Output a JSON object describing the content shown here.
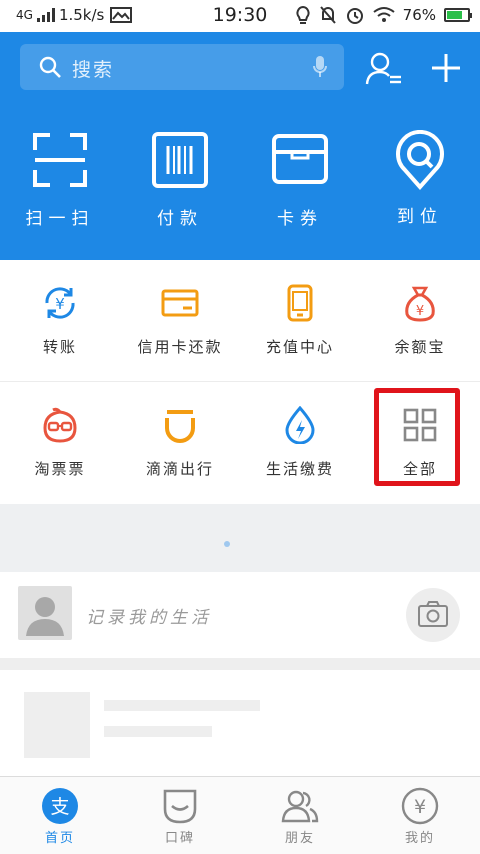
{
  "status_bar": {
    "network": "4G",
    "speed": "1.5k/s",
    "time": "19:30",
    "battery": "76%",
    "battery_level": 0.76
  },
  "header": {
    "search_placeholder": "搜索",
    "shortcuts": [
      {
        "label": "扫一扫",
        "icon": "scan-icon"
      },
      {
        "label": "付款",
        "icon": "barcode-icon"
      },
      {
        "label": "卡券",
        "icon": "wallet-icon"
      },
      {
        "label": "到位",
        "icon": "location-icon"
      }
    ]
  },
  "services": [
    {
      "label": "转账",
      "icon": "transfer-icon",
      "color": "#1e88e5"
    },
    {
      "label": "信用卡还款",
      "icon": "credit-card-icon",
      "color": "#f39c12"
    },
    {
      "label": "充值中心",
      "icon": "phone-icon",
      "color": "#f39c12"
    },
    {
      "label": "余额宝",
      "icon": "money-bag-icon",
      "color": "#e8553e"
    },
    {
      "label": "淘票票",
      "icon": "ticket-mascot-icon",
      "color": "#e8553e"
    },
    {
      "label": "滴滴出行",
      "icon": "didi-icon",
      "color": "#f39c12"
    },
    {
      "label": "生活缴费",
      "icon": "water-drop-icon",
      "color": "#1e88e5"
    },
    {
      "label": "全部",
      "icon": "grid-icon",
      "color": "#888888"
    }
  ],
  "post": {
    "placeholder": "记录我的生活"
  },
  "tabbar": {
    "tabs": [
      {
        "label": "首页",
        "icon": "alipay-home-icon",
        "active": true
      },
      {
        "label": "口碑",
        "icon": "koubei-icon",
        "active": false
      },
      {
        "label": "朋友",
        "icon": "friends-icon",
        "active": false
      },
      {
        "label": "我的",
        "icon": "yuan-icon",
        "active": false
      }
    ]
  },
  "colors": {
    "brand_blue": "#1e88e5",
    "annotation_red": "#e0141b"
  }
}
